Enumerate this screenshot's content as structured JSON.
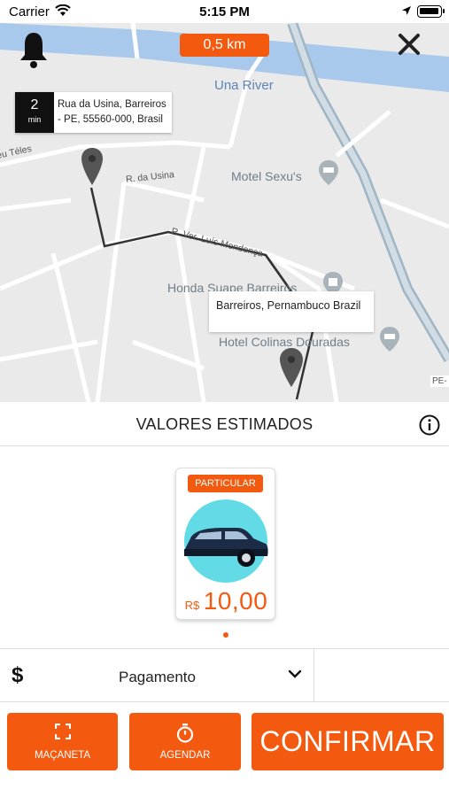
{
  "status_bar": {
    "carrier": "Carrier",
    "time": "5:15 PM"
  },
  "map": {
    "distance": "0,5 km",
    "river_label": "Una River",
    "street_labels": [
      "eu Téles",
      "R. da Usina",
      "R. Ver. Luís Mendonça"
    ],
    "poi_labels": [
      "Motel Sexu's",
      "Honda Suape Barreiros",
      "Hotel Colinas Douradas"
    ],
    "corner_tag": "PE-",
    "origin": {
      "eta_value": "2",
      "eta_unit": "min",
      "address": "Rua da Usina, Barreiros - PE, 55560-000, Brasil"
    },
    "destination": {
      "address": "Barreiros, Pernambuco Brazil"
    }
  },
  "estimates": {
    "title": "VALORES ESTIMADOS"
  },
  "vehicle": {
    "category": "PARTICULAR",
    "currency": "R$",
    "price": "10,00"
  },
  "payment": {
    "label": "Pagamento"
  },
  "actions": {
    "macaneta": "MAÇANETA",
    "agendar": "AGENDAR",
    "confirmar": "CONFIRMAR"
  },
  "colors": {
    "accent": "#f45a0f",
    "map_bg": "#eaeaea",
    "river": "#a8c8ec"
  },
  "icons": [
    "bell-icon",
    "close-icon",
    "map-pin-icon",
    "info-icon",
    "dollar-icon",
    "chevron-down-icon",
    "fullscreen-icon",
    "timer-icon",
    "car-icon"
  ]
}
